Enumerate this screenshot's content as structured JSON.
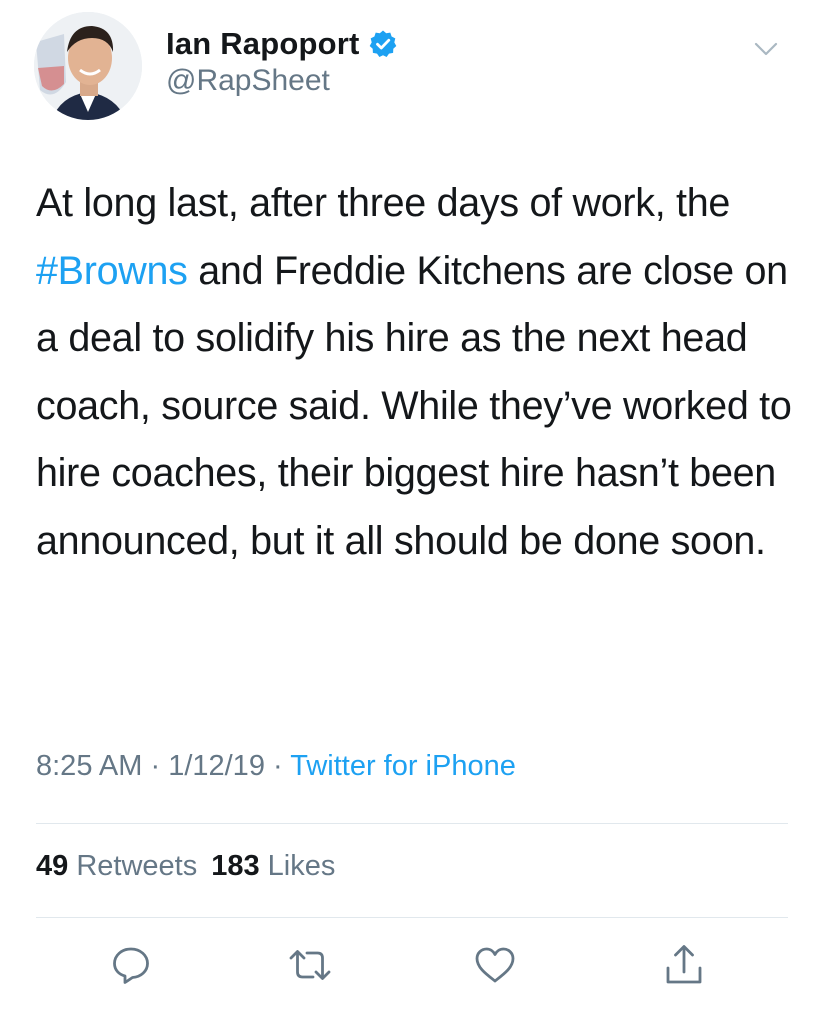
{
  "author": {
    "display_name": "Ian Rapoport",
    "handle": "@RapSheet",
    "verified": true,
    "avatar_icon": "profile-photo-with-nfl-logo"
  },
  "tweet": {
    "text_before": "At long last, after three days of work, the ",
    "hashtag": "#Browns",
    "text_after": " and Freddie Kitchens are close on a deal to solidify his hire as the next head coach, source said. While they’ve worked to hire coaches, their biggest hire hasn’t been announced, but it all should be done soon."
  },
  "meta": {
    "time": "8:25 AM",
    "separator": " · ",
    "date": "1/12/19",
    "source": "Twitter for iPhone"
  },
  "stats": {
    "retweets_count": "49",
    "retweets_label": "Retweets",
    "likes_count": "183",
    "likes_label": "Likes"
  },
  "actions": [
    {
      "name": "reply",
      "icon": "speech-bubble-icon"
    },
    {
      "name": "retweet",
      "icon": "retweet-arrows-icon"
    },
    {
      "name": "like",
      "icon": "heart-icon"
    },
    {
      "name": "share",
      "icon": "share-upload-icon"
    }
  ],
  "colors": {
    "accent": "#1da1f2",
    "text": "#14171a",
    "secondary": "#657786",
    "divider": "#e1e8ed"
  }
}
